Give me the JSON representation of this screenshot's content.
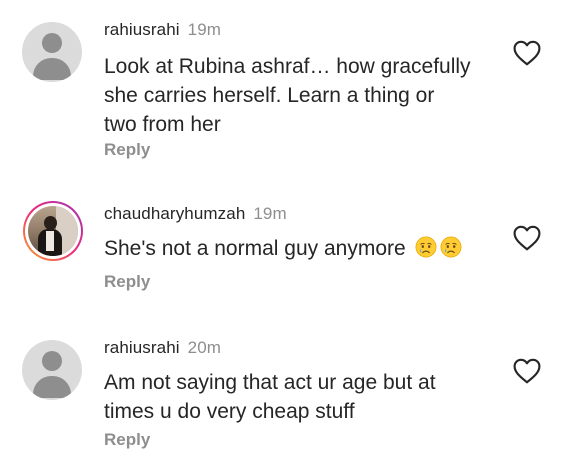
{
  "comments": [
    {
      "username": "rahiusrahi",
      "time": "19m",
      "text_lines": [
        "Look at Rubina ashraf… how gracefully",
        "she carries herself. Learn a thing or",
        "two from her"
      ],
      "reply_label": "Reply",
      "avatar": "default-avatar-icon"
    },
    {
      "username": "chaudharyhumzah",
      "time": "19m",
      "text": "She's not a normal guy anymore",
      "emojis": [
        "crying-face-emoji",
        "crying-face-emoji"
      ],
      "reply_label": "Reply",
      "avatar": "profile-photo"
    },
    {
      "username": "rahiusrahi",
      "time": "20m",
      "text_lines": [
        "Am not saying that act ur age but at",
        "times u do very cheap stuff"
      ],
      "reply_label": "Reply",
      "avatar": "default-avatar-icon"
    }
  ],
  "icons": {
    "like": "heart-outline-icon"
  },
  "colors": {
    "primary_text": "#262626",
    "secondary_text": "#8e8e8e",
    "avatar_bg": "#dbdbdb",
    "avatar_fg": "#8e8e8e"
  }
}
